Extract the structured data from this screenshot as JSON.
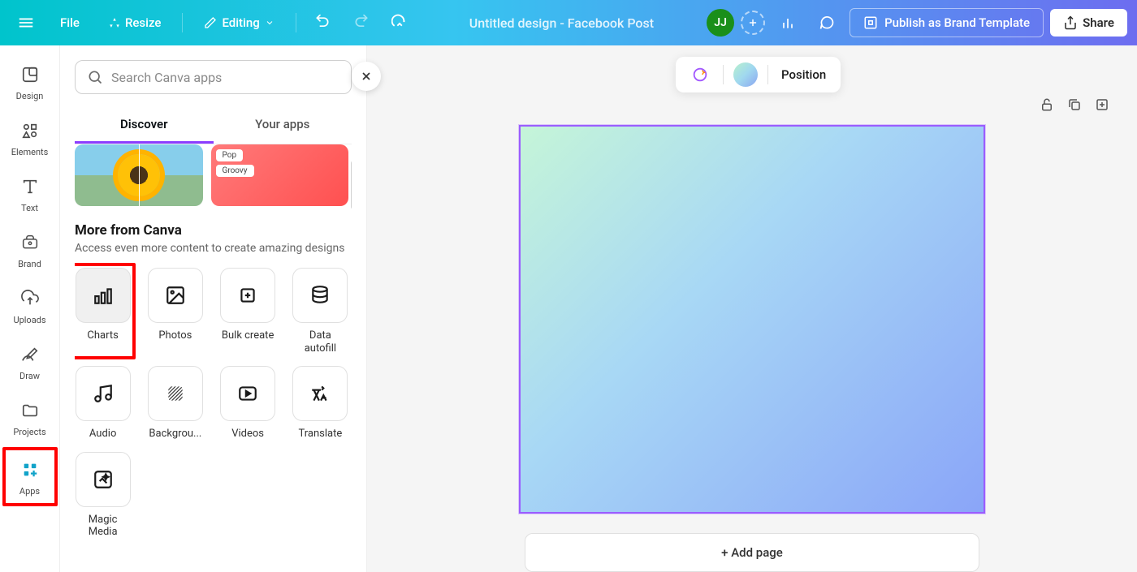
{
  "topbar": {
    "file": "File",
    "resize": "Resize",
    "editing": "Editing",
    "doc_title": "Untitled design - Facebook Post",
    "avatar_initials": "JJ",
    "publish": "Publish as Brand Template",
    "share": "Share"
  },
  "rail": {
    "items": [
      {
        "id": "design",
        "label": "Design"
      },
      {
        "id": "elements",
        "label": "Elements"
      },
      {
        "id": "text",
        "label": "Text"
      },
      {
        "id": "brand",
        "label": "Brand"
      },
      {
        "id": "uploads",
        "label": "Uploads"
      },
      {
        "id": "draw",
        "label": "Draw"
      },
      {
        "id": "projects",
        "label": "Projects"
      },
      {
        "id": "apps",
        "label": "Apps"
      }
    ]
  },
  "panel": {
    "search_placeholder": "Search Canva apps",
    "tabs": {
      "discover": "Discover",
      "your_apps": "Your apps"
    },
    "chips": [
      "Pop",
      "Groovy"
    ],
    "section_title": "More from Canva",
    "section_sub": "Access even more content to create amazing designs",
    "apps": [
      {
        "id": "charts",
        "label": "Charts"
      },
      {
        "id": "photos",
        "label": "Photos"
      },
      {
        "id": "bulk-create",
        "label": "Bulk create"
      },
      {
        "id": "data-autofill",
        "label": "Data autofill"
      },
      {
        "id": "audio",
        "label": "Audio"
      },
      {
        "id": "background",
        "label": "Backgrou..."
      },
      {
        "id": "videos",
        "label": "Videos"
      },
      {
        "id": "translate",
        "label": "Translate"
      },
      {
        "id": "magic-media",
        "label": "Magic Media"
      }
    ]
  },
  "canvas": {
    "position": "Position",
    "add_page": "+ Add page"
  }
}
